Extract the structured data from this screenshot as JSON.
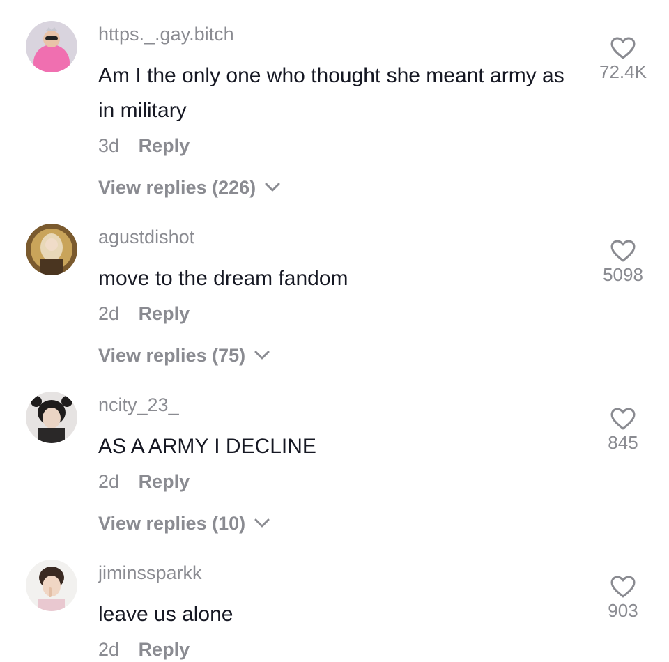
{
  "comments": [
    {
      "username": "https._.gay.bitch",
      "text": "Am I the only one who thought she meant army as in military",
      "time": "3d",
      "reply_label": "Reply",
      "view_replies": "View replies (226)",
      "likes": "72.4K"
    },
    {
      "username": "agustdishot",
      "text": "move to the dream fandom",
      "time": "2d",
      "reply_label": "Reply",
      "view_replies": "View replies (75)",
      "likes": "5098"
    },
    {
      "username": "ncity_23_",
      "text": "AS A ARMY I DECLINE",
      "time": "2d",
      "reply_label": "Reply",
      "view_replies": "View replies (10)",
      "likes": "845"
    },
    {
      "username": "jiminssparkk",
      "text": "leave us alone",
      "time": "2d",
      "reply_label": "Reply",
      "likes": "903"
    }
  ],
  "colors": {
    "secondary_text": "#8a8b91",
    "primary_text": "#161823",
    "background": "#ffffff"
  },
  "icons": {
    "like": "heart-outline-icon",
    "expand": "chevron-down-icon"
  }
}
